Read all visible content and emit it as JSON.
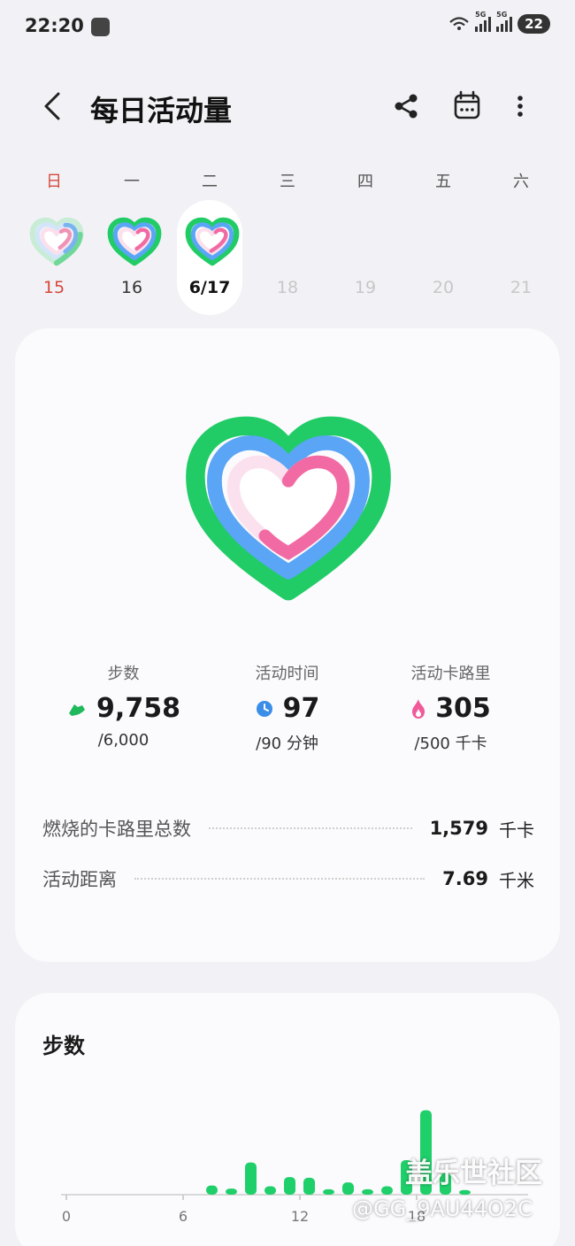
{
  "status_bar": {
    "time": "22:20",
    "signal_1_label": "5G",
    "signal_2_label": "5G",
    "battery": "22"
  },
  "header": {
    "title": "每日活动量"
  },
  "week": {
    "days": [
      {
        "name": "日",
        "num": "15",
        "sunday": true
      },
      {
        "name": "一",
        "num": "16"
      },
      {
        "name": "二",
        "num": "6/17",
        "selected": true
      },
      {
        "name": "三",
        "num": "18"
      },
      {
        "name": "四",
        "num": "19"
      },
      {
        "name": "五",
        "num": "20"
      },
      {
        "name": "六",
        "num": "21"
      }
    ]
  },
  "stats": {
    "steps": {
      "label": "步数",
      "value": "9,758",
      "goal": "/6,000"
    },
    "active_time": {
      "label": "活动时间",
      "value": "97",
      "goal": "/90 分钟"
    },
    "active_calories": {
      "label": "活动卡路里",
      "value": "305",
      "goal": "/500 千卡"
    }
  },
  "metrics": {
    "total_calories": {
      "label": "燃烧的卡路里总数",
      "value": "1,579",
      "unit": "千卡"
    },
    "distance": {
      "label": "活动距离",
      "value": "7.69",
      "unit": "千米"
    }
  },
  "steps_section": {
    "title": "步数"
  },
  "chart_data": {
    "type": "bar",
    "x_tick_labels": [
      "0",
      "6",
      "12",
      "18"
    ],
    "x_hours": [
      7,
      8,
      9,
      10,
      11,
      12,
      13,
      14,
      15,
      16,
      17,
      18,
      19,
      20
    ],
    "values": [
      120,
      80,
      420,
      110,
      230,
      220,
      70,
      160,
      70,
      110,
      450,
      1100,
      280,
      60
    ],
    "ylim": [
      0,
      1200
    ],
    "bar_color": "#1fcf6a"
  },
  "watermark": {
    "line1": "盖乐世社区",
    "line2": "@GG_9AU44O2C"
  },
  "colors": {
    "green": "#21cc66",
    "blue": "#5aa5f5",
    "pink": "#f26aa3",
    "sunday_red": "#d6483c"
  }
}
